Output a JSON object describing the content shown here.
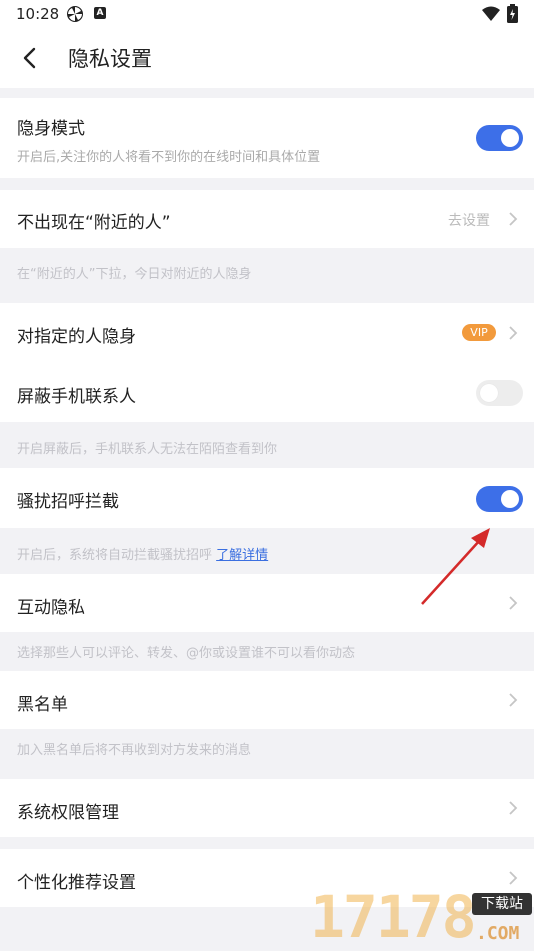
{
  "status_bar": {
    "time": "10:28",
    "icons": [
      "pinwheel-icon",
      "a-badge-icon",
      "wifi-icon",
      "battery-icon"
    ]
  },
  "header": {
    "back_icon": "chevron-left-icon",
    "title": "隐私设置"
  },
  "settings": {
    "stealth_mode": {
      "label": "隐身模式",
      "description": "开启后,关注你的人将看不到你的在线时间和具体位置",
      "enabled": true
    },
    "nearby": {
      "label": "不出现在“附近的人”",
      "action_text": "去设置",
      "hint": "在“附近的人”下拉，今日对附近的人隐身"
    },
    "hide_from_specific": {
      "label": "对指定的人隐身",
      "badge": "VIP"
    },
    "block_contacts": {
      "label": "屏蔽手机联系人",
      "enabled": false,
      "hint": "开启屏蔽后，手机联系人无法在陌陌查看到你"
    },
    "harassment_filter": {
      "label": "骚扰招呼拦截",
      "enabled": true,
      "hint": "开启后，系统将自动拦截骚扰招呼",
      "learn_more": "了解详情"
    },
    "interaction_privacy": {
      "label": "互动隐私",
      "hint": "选择那些人可以评论、转发、@你或设置谁不可以看你动态"
    },
    "blacklist": {
      "label": "黑名单",
      "hint": "加入黑名单后将不再收到对方发来的消息"
    },
    "system_permissions": {
      "label": "系统权限管理"
    },
    "personalized_recommendation": {
      "label": "个性化推荐设置"
    }
  },
  "watermark": {
    "digits": "17178",
    "badge": "下载站",
    "domain": ".COM"
  },
  "colors": {
    "accent": "#3d6fe8",
    "vip": "#f29a3c",
    "annotation_arrow": "#d42a2a",
    "hint_text": "#c2c2c8"
  }
}
